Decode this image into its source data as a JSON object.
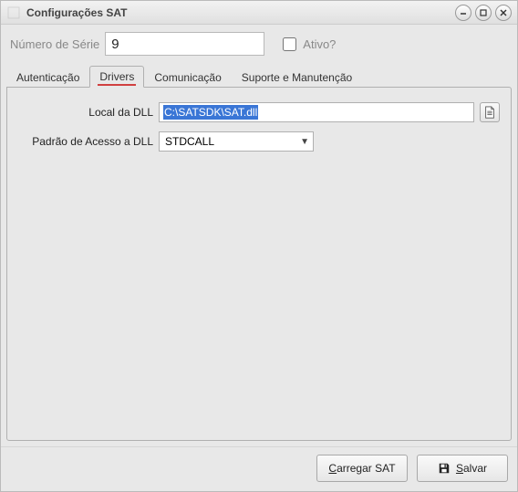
{
  "window": {
    "title": "Configurações SAT"
  },
  "header": {
    "serial_label": "Número de Série",
    "serial_value": "9",
    "ativo_label": "Ativo?",
    "ativo_checked": false
  },
  "tabs": [
    {
      "label": "Autenticação",
      "active": false
    },
    {
      "label": "Drivers",
      "active": true
    },
    {
      "label": "Comunicação",
      "active": false
    },
    {
      "label": "Suporte e Manutenção",
      "active": false
    }
  ],
  "drivers": {
    "dll_path_label": "Local da DLL",
    "dll_path_value": "C:\\SATSDK\\SAT.dll",
    "access_pattern_label": "Padrão de Acesso a DLL",
    "access_pattern_value": "STDCALL"
  },
  "footer": {
    "load_sat": {
      "full": "Carregar SAT",
      "prefix": "C",
      "rest": "arregar SAT"
    },
    "save": {
      "full": "Salvar",
      "prefix": "S",
      "rest": "alvar"
    }
  }
}
